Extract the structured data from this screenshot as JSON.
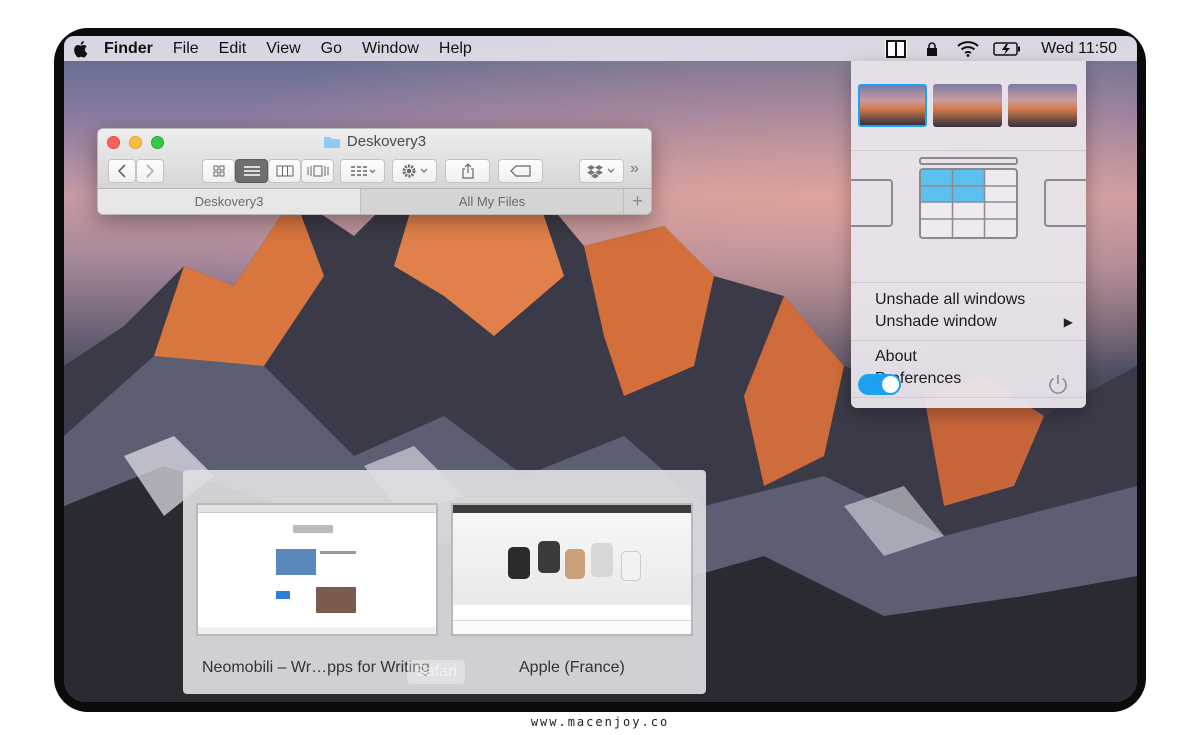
{
  "menubar": {
    "app": "Finder",
    "items": [
      "File",
      "Edit",
      "View",
      "Go",
      "Window",
      "Help"
    ],
    "status_icons": [
      "deskovery-icon",
      "lock-icon",
      "wifi-icon",
      "battery-charging-icon"
    ],
    "clock": "Wed 11:50"
  },
  "finder": {
    "title": "Deskovery3",
    "tabs": [
      "Deskovery3",
      "All My Files"
    ],
    "add_tab": "+",
    "overflow": "»"
  },
  "panel": {
    "menu_group1": [
      "Unshade all windows",
      "Unshade window"
    ],
    "submenu_arrow": "▶",
    "menu_group2": [
      "About",
      "Preferences"
    ],
    "toggle_on": true
  },
  "switcher": {
    "windows": [
      "Neomobili – Wr…pps for Writing",
      "Apple (France)"
    ],
    "app_label": "Safari"
  },
  "watermark": "www.macenjoy.co",
  "colors": {
    "accent": "#1ba1f0",
    "grid_highlight": "#5cc0ef"
  }
}
